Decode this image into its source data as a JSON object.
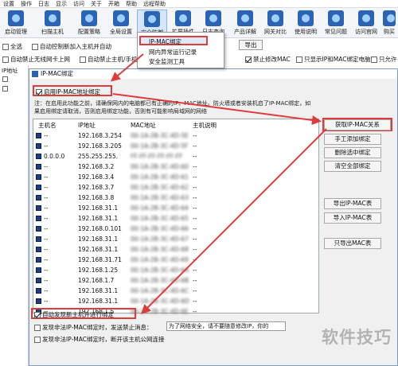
{
  "menubar": [
    "设置",
    "操作",
    "日志",
    "显示",
    "访问",
    "关于",
    "开箱",
    "帮助",
    "远程帮助"
  ],
  "toolbar": [
    {
      "label": "启动管理",
      "icon": "play-icon"
    },
    {
      "label": "扫描主机",
      "icon": "scan-icon"
    },
    {
      "label": "配置策略",
      "icon": "policy-icon"
    },
    {
      "label": "全局设置",
      "icon": "settings-icon"
    },
    {
      "label": "安全防御",
      "icon": "shield-icon"
    },
    {
      "label": "扩展插件",
      "icon": "plugin-icon"
    },
    {
      "label": "日志查询",
      "icon": "log-icon"
    },
    {
      "label": "产品详解",
      "icon": "info-icon"
    },
    {
      "label": "网关对比",
      "icon": "compare-icon"
    },
    {
      "label": "使用说明",
      "icon": "doc-icon"
    },
    {
      "label": "常见问题",
      "icon": "help-icon"
    },
    {
      "label": "访问官网",
      "icon": "web-icon"
    },
    {
      "label": "购买",
      "icon": "cart-icon"
    }
  ],
  "options": {
    "select_all": "全选",
    "auto_control": "自动控制新加入主机并自动",
    "auto_block_wifi": "自动禁止无线网卡上网",
    "auto_block_mobile": "自动禁止主机/手机",
    "forbid_modify_mac": "禁止修改MAC",
    "only_show_ip_mac": "只显示IP和MAC绑定电脑",
    "only_conflict": "只允许",
    "export": "导出"
  },
  "dropdown": {
    "items": [
      "IP-MAC绑定",
      "网内异常运行记录",
      "安全监测工具"
    ]
  },
  "left_tree": {
    "header": "IP地址"
  },
  "dialog": {
    "title": "IP-MAC绑定",
    "enable_label": "启用IP-MAC地址绑定",
    "notice_1": "注：在启用此功能之前，请确保网内的电脑都已有正确的IP、MAC地址。防火墙或者安装机启了IP-MAC绑定，如",
    "notice_2": "果启用绑定请取消，否则启用绑定功能，否则有可能影响局域网的网络",
    "columns": [
      "主机名",
      "IP地址",
      "MAC地址",
      "主机说明"
    ],
    "rows": [
      {
        "name": "--",
        "ip": "192.168.3.254",
        "mac": "00-1A-2B-3C-4D-5E",
        "desc": "--"
      },
      {
        "name": "--",
        "ip": "192.168.3.205",
        "mac": "00-1A-2B-3C-4D-5F",
        "desc": "--"
      },
      {
        "name": "0.0.0.0",
        "ip": "255.255.255.",
        "mac": "FF-FF-FF-FF-FF-FF",
        "desc": "--"
      },
      {
        "name": "--",
        "ip": "192.168.3.2",
        "mac": "00-1A-2B-3C-4D-60",
        "desc": "--"
      },
      {
        "name": "--",
        "ip": "192.168.3.4",
        "mac": "00-1A-2B-3C-4D-61",
        "desc": "--"
      },
      {
        "name": "--",
        "ip": "192.168.3.7",
        "mac": "00-1A-2B-3C-4D-62",
        "desc": "--"
      },
      {
        "name": "--",
        "ip": "192.168.3.8",
        "mac": "00-1A-2B-3C-4D-63",
        "desc": "--"
      },
      {
        "name": "--",
        "ip": "192.168.31.1",
        "mac": "00-1A-2B-3C-4D-64",
        "desc": "--"
      },
      {
        "name": "--",
        "ip": "192.168.31.1",
        "mac": "00-1A-2B-3C-4D-65",
        "desc": "--"
      },
      {
        "name": "--",
        "ip": "192.168.0.101",
        "mac": "00-1A-2B-3C-4D-66",
        "desc": "--"
      },
      {
        "name": "--",
        "ip": "192.168.31.1",
        "mac": "00-1A-2B-3C-4D-67",
        "desc": "--"
      },
      {
        "name": "--",
        "ip": "192.168.31.1",
        "mac": "00-1A-2B-3C-4D-68",
        "desc": "--"
      },
      {
        "name": "--",
        "ip": "192.168.31.71",
        "mac": "00-1A-2B-3C-4D-69",
        "desc": "--"
      },
      {
        "name": "--",
        "ip": "192.168.1.25",
        "mac": "00-1A-2B-3C-4D-6A",
        "desc": "--"
      },
      {
        "name": "--",
        "ip": "192.168.1.7",
        "mac": "00-1A-2B-3C-4D-6B",
        "desc": "--"
      },
      {
        "name": "--",
        "ip": "192.168.31.1",
        "mac": "00-1A-2B-3C-4D-6C",
        "desc": "--"
      },
      {
        "name": "--",
        "ip": "192.168.31.1",
        "mac": "00-1A-2B-3C-4D-6D",
        "desc": "--"
      },
      {
        "name": "--",
        "ip": "192.168.1.5",
        "mac": "00-1A-2B-3C-4D-6E",
        "desc": "--"
      }
    ],
    "buttons": {
      "fetch": "获取IP-MAC关系",
      "manual_add": "手工添加绑定",
      "delete_selected": "删除选中绑定",
      "clear_all": "清空全部绑定",
      "export": "导出IP-MAC表",
      "import": "导入IP-MAC表",
      "save": "只导出MAC表"
    },
    "auto_bind_label": "自动发现新主机并进行绑定",
    "illegal_send_label": "发现非法IP-MAC绑定时，发送禁止消息：",
    "illegal_send_value": "为了网络安全，请不要随意修改IP，你的",
    "illegal_disconnect_label": "发现非法IP-MAC绑定时，断开该主机公网连接"
  },
  "watermark": "软件技巧"
}
